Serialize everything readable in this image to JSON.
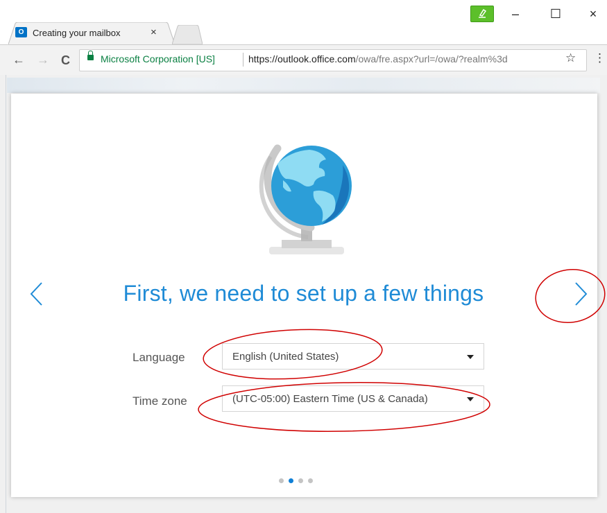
{
  "browser": {
    "tab": {
      "icon_text": "O",
      "title": "Creating your mailbox",
      "close_glyph": "×"
    },
    "window_controls": {
      "minimize": "–",
      "maximize": "☐",
      "close": "×"
    },
    "nav": {
      "back": "←",
      "forward": "→",
      "reload": "C"
    },
    "address": {
      "ev_name": "Microsoft Corporation [US]",
      "url_host": "https://outlook.office.com",
      "url_path": "/owa/fre.aspx?url=/owa/?realm%3d"
    },
    "bookmark_glyph": "☆",
    "menu_glyph": "⋮"
  },
  "setup": {
    "headline": "First, we need to set up a few things",
    "language": {
      "label": "Language",
      "value": "English (United States)"
    },
    "timezone": {
      "label": "Time zone",
      "value": "(UTC-05:00) Eastern Time (US & Canada)"
    },
    "pager": {
      "total": 4,
      "current": 2
    }
  },
  "colors": {
    "accent": "#1f8bd6",
    "annotation": "#d00000",
    "ev_green": "#0b8043"
  },
  "icons": {
    "illustration": "globe-icon",
    "prev": "chevron-left-icon",
    "next": "chevron-right-icon",
    "lock": "lock-icon",
    "extension": "extension-icon"
  }
}
